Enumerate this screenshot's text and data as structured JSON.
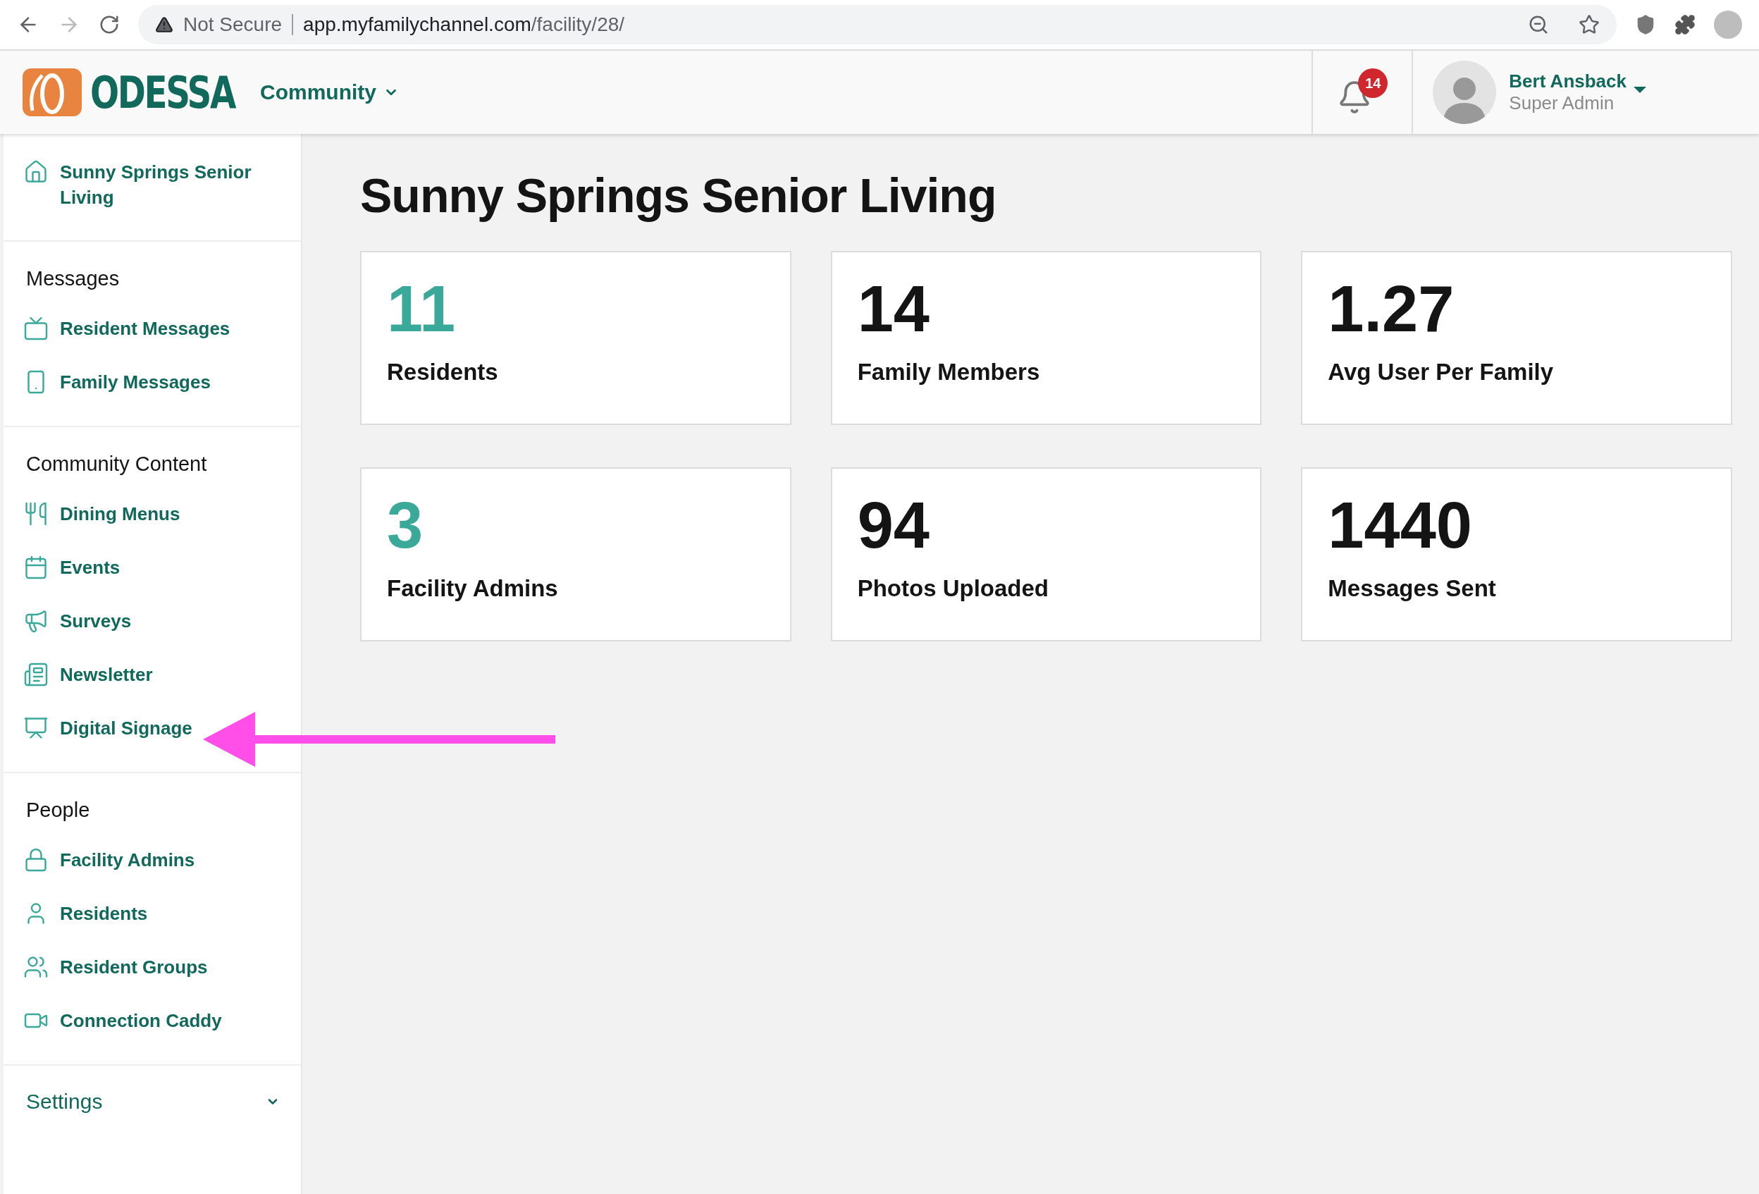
{
  "browser": {
    "security": "Not Secure",
    "url_host": "app.myfamilychannel.com",
    "url_path": "/facility/28/"
  },
  "header": {
    "logo_text": "ODESSA",
    "menu": "Community",
    "notifications": "14",
    "user_name": "Bert Ansback",
    "user_role": "Super Admin"
  },
  "sidebar": {
    "home": {
      "label": "Sunny Springs Senior Living",
      "kind": "home"
    },
    "sections": [
      {
        "title": "Messages",
        "items": [
          {
            "label": "Resident Messages",
            "kind": "tv"
          },
          {
            "label": "Family Messages",
            "kind": "phone"
          }
        ]
      },
      {
        "title": "Community Content",
        "items": [
          {
            "label": "Dining Menus",
            "kind": "dining"
          },
          {
            "label": "Events",
            "kind": "calendar"
          },
          {
            "label": "Surveys",
            "kind": "megaphone"
          },
          {
            "label": "Newsletter",
            "kind": "newspaper"
          },
          {
            "label": "Digital Signage",
            "kind": "monitor"
          }
        ]
      },
      {
        "title": "People",
        "items": [
          {
            "label": "Facility Admins",
            "kind": "lock"
          },
          {
            "label": "Residents",
            "kind": "person"
          },
          {
            "label": "Resident Groups",
            "kind": "group"
          },
          {
            "label": "Connection Caddy",
            "kind": "video"
          }
        ]
      }
    ],
    "settings": {
      "label": "Settings",
      "expanded": false
    }
  },
  "main": {
    "title": "Sunny Springs Senior Living",
    "stats": [
      {
        "value": "11",
        "label": "Residents",
        "color": "#3aa999"
      },
      {
        "value": "14",
        "label": "Family Members",
        "color": "#141414"
      },
      {
        "value": "1.27",
        "label": "Avg User Per Family",
        "color": "#141414"
      },
      {
        "value": "3",
        "label": "Facility Admins",
        "color": "#3aa999"
      },
      {
        "value": "94",
        "label": "Photos Uploaded",
        "color": "#141414"
      },
      {
        "value": "1440",
        "label": "Messages Sent",
        "color": "#141414"
      }
    ]
  }
}
